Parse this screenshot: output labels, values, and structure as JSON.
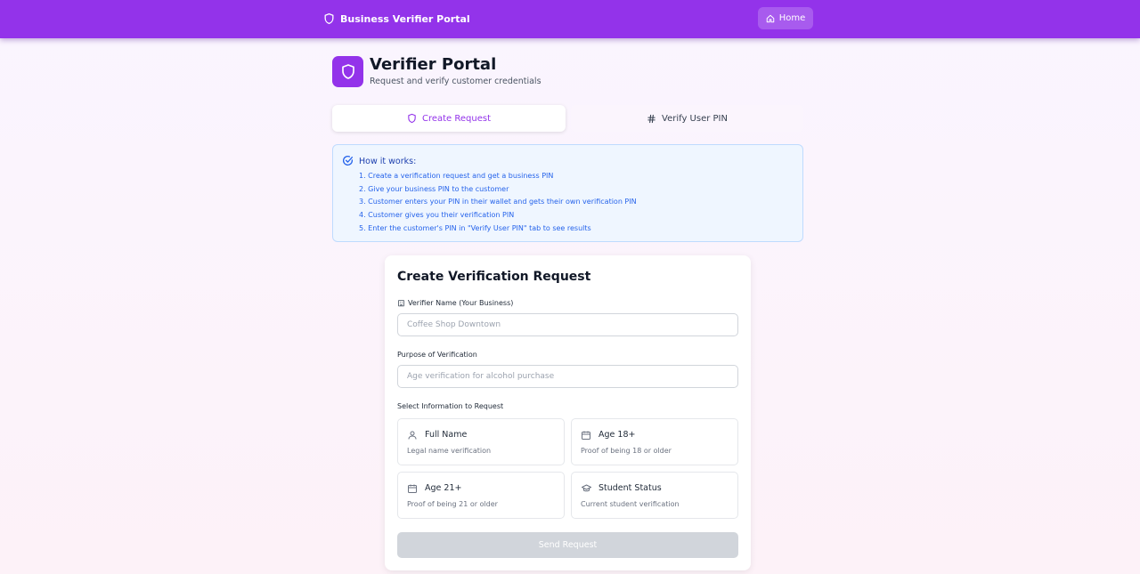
{
  "header": {
    "brand_title": "Business Verifier Portal",
    "brand_icon": "shield-icon",
    "home_label": "Home",
    "home_icon": "home-icon",
    "accent_color": "#9333ea"
  },
  "portal": {
    "title": "Verifier Portal",
    "subtitle": "Request and verify customer credentials",
    "logo_icon": "shield-icon"
  },
  "tabs": [
    {
      "label": "Create Request",
      "icon": "shield-icon",
      "active": true
    },
    {
      "label": "Verify User PIN",
      "icon": "hash-icon",
      "active": false
    }
  ],
  "info": {
    "title": "How it works:",
    "icon": "check-circle-icon",
    "steps": [
      "1. Create a verification request and get a business PIN",
      "2. Give your business PIN to the customer",
      "3. Customer enters your PIN in their wallet and gets their own verification PIN",
      "4. Customer gives you their verification PIN",
      "5. Enter the customer's PIN in \"Verify User PIN\" tab to see results"
    ]
  },
  "form": {
    "title": "Create Verification Request",
    "verifier_name": {
      "label": "Verifier Name (Your Business)",
      "icon": "building-icon",
      "placeholder": "Coffee Shop Downtown",
      "value": ""
    },
    "purpose": {
      "label": "Purpose of Verification",
      "placeholder": "Age verification for alcohol purchase",
      "value": ""
    },
    "select_label": "Select Information to Request",
    "options": [
      {
        "title": "Full Name",
        "desc": "Legal name verification",
        "icon": "user-icon",
        "selected": false
      },
      {
        "title": "Age 18+",
        "desc": "Proof of being 18 or older",
        "icon": "calendar-icon",
        "selected": false
      },
      {
        "title": "Age 21+",
        "desc": "Proof of being 21 or older",
        "icon": "calendar-icon",
        "selected": false
      },
      {
        "title": "Student Status",
        "desc": "Current student verification",
        "icon": "graduation-cap-icon",
        "selected": false
      }
    ],
    "submit_label": "Send Request",
    "submit_disabled": true
  }
}
